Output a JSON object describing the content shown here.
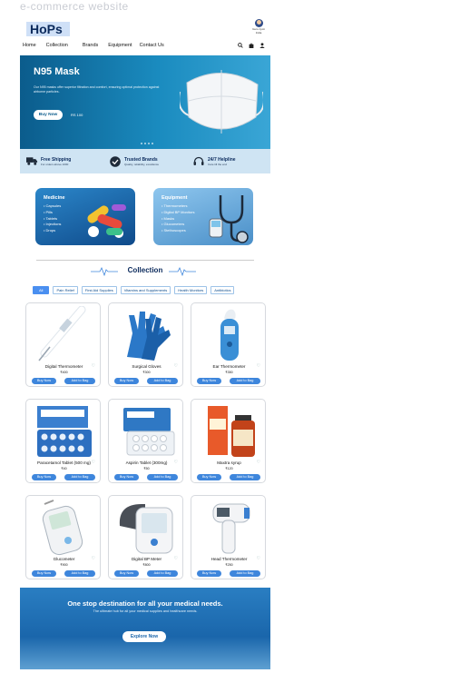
{
  "caption": "e-commerce website",
  "header": {
    "logo": "HoPs",
    "user_name": "Guru Jyoti",
    "user_location": "India",
    "nav": [
      "Home",
      "Collection",
      "Brands",
      "Equipment",
      "Contact Us"
    ],
    "icons": [
      "search-icon",
      "bag-icon",
      "user-icon"
    ]
  },
  "hero": {
    "title": "N95 Mask",
    "description": "Our N95 masks offer superior filtration and comfort, ensuring optimal protection against airborne particles.",
    "button": "Buy Now",
    "price": "RS 100"
  },
  "features": [
    {
      "title": "Free Shipping",
      "subtitle": "For orders above 1000",
      "icon": "truck-icon"
    },
    {
      "title": "Trusted Brands",
      "subtitle": "Quality, reliability, excellence",
      "icon": "check-circle-icon"
    },
    {
      "title": "24/7 Helpline",
      "subtitle": "Care till the end",
      "icon": "headset-icon"
    }
  ],
  "categories": {
    "medicine": {
      "title": "Medicine",
      "items": [
        "Capsules",
        "Pills",
        "Tablets",
        "Injections",
        "Drops"
      ]
    },
    "equipment": {
      "title": "Equipment",
      "items": [
        "Thermometers",
        "Digital BP Monitors",
        "Masks",
        "Glucometers",
        "Stethoscopes"
      ]
    }
  },
  "collection": {
    "title": "Collection",
    "filters": [
      "All",
      "Pain Relief",
      "First Aid Supplies",
      "Vitamins and Supplements",
      "Health Monitors",
      "Antibiotics"
    ]
  },
  "products": [
    {
      "name": "Digital Thermometer",
      "price": "₹400"
    },
    {
      "name": "Surgical Gloves",
      "price": "₹300"
    },
    {
      "name": "Ear Thermometer",
      "price": "₹350"
    },
    {
      "name": "Paracetamol Tablet (500 mg)",
      "price": "₹40"
    },
    {
      "name": "Aspirin Tablet (300mg)",
      "price": "₹50"
    },
    {
      "name": "Maxtra syrup",
      "price": "₹120"
    },
    {
      "name": "Glucometer",
      "price": "₹900"
    },
    {
      "name": "Digital BP Meter",
      "price": "₹800"
    },
    {
      "name": "Head Thermometer",
      "price": "₹250"
    }
  ],
  "product_buttons": {
    "buy": "Buy Now",
    "bag": "Add to Bag"
  },
  "promo": {
    "title": "One stop destination for all your medical needs.",
    "subtitle": "The ultimate hub for all your medical supplies and healthcare needs.",
    "button": "Explore Now"
  },
  "colors": {
    "primary": "#0b5c8c",
    "accent": "#3e86dc",
    "navy": "#0b2a5c"
  }
}
